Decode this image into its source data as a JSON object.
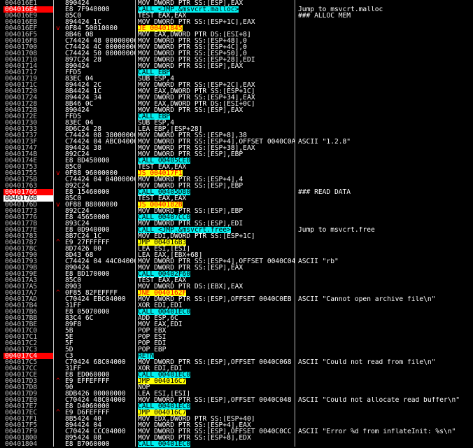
{
  "colors": {
    "background": "#000000",
    "breakpoint": "#ff0000",
    "selected": "#ffffff",
    "call_highlight": "#00f0f0",
    "jump_highlight": "#ffff00",
    "jump_arrow": "#ff0000"
  },
  "rows": [
    {
      "addr": "004016E1",
      "arrow": "",
      "hex": "890424",
      "asm": "MOV DWORD PTR SS:[ESP],EAX",
      "cmt": ""
    },
    {
      "addr": "004016E4",
      "arrow": "",
      "hex": "E8 7F940000",
      "asm": "CALL <JMP.&msvcrt.malloc>",
      "cmt": "Jump to msvcrt.malloc",
      "type": "call",
      "mark": "bp"
    },
    {
      "addr": "004016E9",
      "arrow": "",
      "hex": "85C0",
      "asm": "TEST EAX,EAX",
      "cmt": "### ALLOC MEM"
    },
    {
      "addr": "004016EB",
      "arrow": "",
      "hex": "894424 1C",
      "asm": "MOV DWORD PTR SS:[ESP+1C],EAX",
      "cmt": ""
    },
    {
      "addr": "004016EF",
      "arrow": "v",
      "hex": "0F84 50010000",
      "asm": "JE 00401845",
      "cmt": "",
      "type": "jcc"
    },
    {
      "addr": "004016F5",
      "arrow": "",
      "hex": "8B46 08",
      "asm": "MOV EAX,DWORD PTR DS:[ESI+8]",
      "cmt": ""
    },
    {
      "addr": "004016F8",
      "arrow": "",
      "hex": "C74424 48 00000000",
      "asm": "MOV DWORD PTR SS:[ESP+48],0",
      "cmt": ""
    },
    {
      "addr": "00401700",
      "arrow": "",
      "hex": "C74424 4C 00000000",
      "asm": "MOV DWORD PTR SS:[ESP+4C],0",
      "cmt": ""
    },
    {
      "addr": "00401708",
      "arrow": "",
      "hex": "C74424 50 00000000",
      "asm": "MOV DWORD PTR SS:[ESP+50],0",
      "cmt": ""
    },
    {
      "addr": "00401710",
      "arrow": "",
      "hex": "897C24 28",
      "asm": "MOV DWORD PTR SS:[ESP+28],EDI",
      "cmt": ""
    },
    {
      "addr": "00401714",
      "arrow": "",
      "hex": "890424",
      "asm": "MOV DWORD PTR SS:[ESP],EAX",
      "cmt": ""
    },
    {
      "addr": "00401717",
      "arrow": "",
      "hex": "FFD5",
      "asm": "CALL EBP",
      "cmt": "",
      "type": "call"
    },
    {
      "addr": "00401719",
      "arrow": "",
      "hex": "83EC 04",
      "asm": "SUB ESP,4",
      "cmt": ""
    },
    {
      "addr": "0040171C",
      "arrow": "",
      "hex": "894424 2C",
      "asm": "MOV DWORD PTR SS:[ESP+2C],EAX",
      "cmt": ""
    },
    {
      "addr": "00401720",
      "arrow": "",
      "hex": "8B4424 1C",
      "asm": "MOV EAX,DWORD PTR SS:[ESP+1C]",
      "cmt": ""
    },
    {
      "addr": "00401724",
      "arrow": "",
      "hex": "894424 34",
      "asm": "MOV DWORD PTR SS:[ESP+34],EAX",
      "cmt": ""
    },
    {
      "addr": "00401728",
      "arrow": "",
      "hex": "8B46 0C",
      "asm": "MOV EAX,DWORD PTR DS:[ESI+0C]",
      "cmt": ""
    },
    {
      "addr": "0040172B",
      "arrow": "",
      "hex": "890424",
      "asm": "MOV DWORD PTR SS:[ESP],EAX",
      "cmt": ""
    },
    {
      "addr": "0040172E",
      "arrow": "",
      "hex": "FFD5",
      "asm": "CALL EBP",
      "cmt": "",
      "type": "call"
    },
    {
      "addr": "00401730",
      "arrow": "",
      "hex": "83EC 04",
      "asm": "SUB ESP,4",
      "cmt": ""
    },
    {
      "addr": "00401733",
      "arrow": "",
      "hex": "8D6C24 28",
      "asm": "LEA EBP,[ESP+28]",
      "cmt": ""
    },
    {
      "addr": "00401737",
      "arrow": "",
      "hex": "C74424 08 38000000",
      "asm": "MOV DWORD PTR SS:[ESP+8],38",
      "cmt": ""
    },
    {
      "addr": "0040173F",
      "arrow": "",
      "hex": "C74424 04 ABC04000",
      "asm": "MOV DWORD PTR SS:[ESP+4],OFFSET 0040C0AB",
      "cmt": "ASCII \"1.2.8\""
    },
    {
      "addr": "00401747",
      "arrow": "",
      "hex": "894424 38",
      "asm": "MOV DWORD PTR SS:[ESP+38],EAX",
      "cmt": ""
    },
    {
      "addr": "0040174B",
      "arrow": "",
      "hex": "892C24",
      "asm": "MOV DWORD PTR SS:[ESP],EBP",
      "cmt": ""
    },
    {
      "addr": "0040174E",
      "arrow": "",
      "hex": "E8 8D450000",
      "asm": "CALL 00405CE0",
      "cmt": "",
      "type": "call"
    },
    {
      "addr": "00401753",
      "arrow": "",
      "hex": "85C0",
      "asm": "TEST EAX,EAX",
      "cmt": ""
    },
    {
      "addr": "00401755",
      "arrow": "v",
      "hex": "0F88 96000000",
      "asm": "JS 004017F1",
      "cmt": "",
      "type": "jcc"
    },
    {
      "addr": "0040175B",
      "arrow": "",
      "hex": "C74424 04 04000000",
      "asm": "MOV DWORD PTR SS:[ESP+4],4",
      "cmt": ""
    },
    {
      "addr": "00401763",
      "arrow": "",
      "hex": "892C24",
      "asm": "MOV DWORD PTR SS:[ESP],EBP",
      "cmt": ""
    },
    {
      "addr": "00401766",
      "arrow": "",
      "hex": "E8 15460000",
      "asm": "CALL 00405D80",
      "cmt": "### READ DATA",
      "type": "call",
      "mark": "bp"
    },
    {
      "addr": "0040176B",
      "arrow": "",
      "hex": "85C0",
      "asm": "TEST EAX,EAX",
      "cmt": "",
      "mark": "sel"
    },
    {
      "addr": "0040176D",
      "arrow": "v",
      "hex": "0F88 B8000000",
      "asm": "JS 0040182B",
      "cmt": "",
      "type": "jcc"
    },
    {
      "addr": "00401773",
      "arrow": "",
      "hex": "892C24",
      "asm": "MOV DWORD PTR SS:[ESP],EBP",
      "cmt": ""
    },
    {
      "addr": "00401776",
      "arrow": "",
      "hex": "E8 45650000",
      "asm": "CALL 00407CC0",
      "cmt": "",
      "type": "call"
    },
    {
      "addr": "0040177B",
      "arrow": "",
      "hex": "893C24",
      "asm": "MOV DWORD PTR SS:[ESP],EDI",
      "cmt": ""
    },
    {
      "addr": "0040177E",
      "arrow": "",
      "hex": "E8 0D940000",
      "asm": "CALL <JMP.&msvcrt.free>",
      "cmt": "Jump to msvcrt.free",
      "type": "call"
    },
    {
      "addr": "00401783",
      "arrow": "",
      "hex": "8B7C24 1C",
      "asm": "MOV EDI,DWORD PTR SS:[ESP+1C]",
      "cmt": ""
    },
    {
      "addr": "00401787",
      "arrow": "^",
      "hex": "E9 27FFFFFF",
      "asm": "JMP 004016B3",
      "cmt": "",
      "type": "jmp"
    },
    {
      "addr": "0040178C",
      "arrow": "",
      "hex": "8D7426 00",
      "asm": "LEA ESI,[ESI]",
      "cmt": ""
    },
    {
      "addr": "00401790",
      "arrow": "",
      "hex": "8D43 68",
      "asm": "LEA EAX,[EBX+68]",
      "cmt": ""
    },
    {
      "addr": "00401793",
      "arrow": "",
      "hex": "C74424 04 44C04000",
      "asm": "MOV DWORD PTR SS:[ESP+4],OFFSET 0040C044",
      "cmt": "ASCII \"rb\""
    },
    {
      "addr": "0040179B",
      "arrow": "",
      "hex": "890424",
      "asm": "MOV DWORD PTR SS:[ESP],EAX",
      "cmt": ""
    },
    {
      "addr": "0040179E",
      "arrow": "",
      "hex": "E8 BD170000",
      "asm": "CALL 00402F60",
      "cmt": "",
      "type": "call"
    },
    {
      "addr": "004017A3",
      "arrow": "",
      "hex": "85C0",
      "asm": "TEST EAX,EAX",
      "cmt": ""
    },
    {
      "addr": "004017A5",
      "arrow": "",
      "hex": "8903",
      "asm": "MOV DWORD PTR DS:[EBX],EAX",
      "cmt": ""
    },
    {
      "addr": "004017A7",
      "arrow": "^",
      "hex": "0F85 82FEFFFF",
      "asm": "JNE 0040162F",
      "cmt": "",
      "type": "jcc"
    },
    {
      "addr": "004017AD",
      "arrow": "",
      "hex": "C70424 EBC04000",
      "asm": "MOV DWORD PTR SS:[ESP],OFFSET 0040C0EB",
      "cmt": "ASCII \"Cannot open archive file\\n\""
    },
    {
      "addr": "004017B4",
      "arrow": "",
      "hex": "31FF",
      "asm": "XOR EDI,EDI",
      "cmt": ""
    },
    {
      "addr": "004017B6",
      "arrow": "",
      "hex": "E8 05070000",
      "asm": "CALL 00401EC0",
      "cmt": "",
      "type": "call"
    },
    {
      "addr": "004017BB",
      "arrow": "",
      "hex": "83C4 6C",
      "asm": "ADD ESP,6C",
      "cmt": ""
    },
    {
      "addr": "004017BE",
      "arrow": "",
      "hex": "89F8",
      "asm": "MOV EAX,EDI",
      "cmt": ""
    },
    {
      "addr": "004017C0",
      "arrow": "",
      "hex": "5B",
      "asm": "POP EBX",
      "cmt": ""
    },
    {
      "addr": "004017C1",
      "arrow": "",
      "hex": "5E",
      "asm": "POP ESI",
      "cmt": ""
    },
    {
      "addr": "004017C2",
      "arrow": "",
      "hex": "5F",
      "asm": "POP EDI",
      "cmt": ""
    },
    {
      "addr": "004017C3",
      "arrow": "",
      "hex": "5D",
      "asm": "POP EBP",
      "cmt": ""
    },
    {
      "addr": "004017C4",
      "arrow": "",
      "hex": "C3",
      "asm": "RETN",
      "cmt": "",
      "type": "ret",
      "mark": "bp"
    },
    {
      "addr": "004017C5",
      "arrow": "",
      "hex": "C70424 68C04000",
      "asm": "MOV DWORD PTR SS:[ESP],OFFSET 0040C068",
      "cmt": "ASCII \"Could not read from file\\n\""
    },
    {
      "addr": "004017CC",
      "arrow": "",
      "hex": "31FF",
      "asm": "XOR EDI,EDI",
      "cmt": ""
    },
    {
      "addr": "004017CE",
      "arrow": "",
      "hex": "E8 ED060000",
      "asm": "CALL 00401EC0",
      "cmt": "",
      "type": "call"
    },
    {
      "addr": "004017D3",
      "arrow": "^",
      "hex": "E9 EFFEFFFF",
      "asm": "JMP 004016C7",
      "cmt": "",
      "type": "jmp"
    },
    {
      "addr": "004017D8",
      "arrow": "",
      "hex": "90",
      "asm": "NOP",
      "cmt": ""
    },
    {
      "addr": "004017D9",
      "arrow": "",
      "hex": "8DB426 00000000",
      "asm": "LEA ESI,[ESI]",
      "cmt": ""
    },
    {
      "addr": "004017E0",
      "arrow": "",
      "hex": "C70424 48C04000",
      "asm": "MOV DWORD PTR SS:[ESP],OFFSET 0040C048",
      "cmt": "ASCII \"Could not allocate read buffer\\n\""
    },
    {
      "addr": "004017E7",
      "arrow": "",
      "hex": "E8 D4060000",
      "asm": "CALL 00401EC0",
      "cmt": "",
      "type": "call"
    },
    {
      "addr": "004017EC",
      "arrow": "^",
      "hex": "E9 D6FEFFFF",
      "asm": "JMP 004016C7",
      "cmt": "",
      "type": "jmp"
    },
    {
      "addr": "004017F1",
      "arrow": "",
      "hex": "8B5424 40",
      "asm": "MOV EDX,DWORD PTR SS:[ESP+40]",
      "cmt": ""
    },
    {
      "addr": "004017F5",
      "arrow": "",
      "hex": "894424 04",
      "asm": "MOV DWORD PTR SS:[ESP+4],EAX",
      "cmt": ""
    },
    {
      "addr": "004017F9",
      "arrow": "",
      "hex": "C70424 CCC04000",
      "asm": "MOV DWORD PTR SS:[ESP],OFFSET 0040C0CC",
      "cmt": "ASCII \"Error %d from inflateInit: %s\\n\""
    },
    {
      "addr": "00401800",
      "arrow": "",
      "hex": "895424 08",
      "asm": "MOV DWORD PTR SS:[ESP+8],EDX",
      "cmt": ""
    },
    {
      "addr": "00401804",
      "arrow": "",
      "hex": "E8 B7060000",
      "asm": "CALL 00401EC0",
      "cmt": "",
      "type": "call"
    }
  ]
}
